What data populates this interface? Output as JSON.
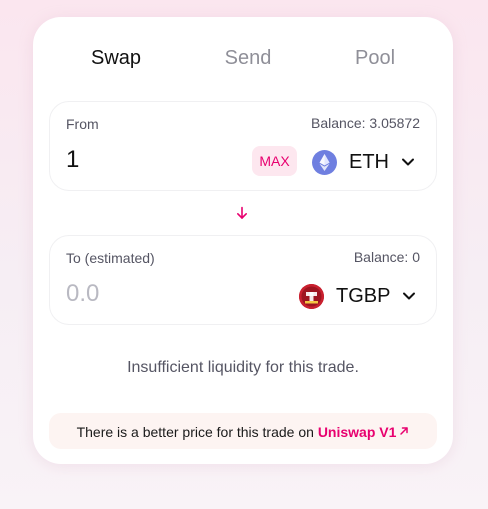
{
  "tabs": {
    "swap": "Swap",
    "send": "Send",
    "pool": "Pool"
  },
  "from_panel": {
    "label": "From",
    "balance": "Balance: 3.05872",
    "amount": "1",
    "max_label": "MAX",
    "token": {
      "symbol": "ETH",
      "icon": "ethereum-icon"
    }
  },
  "to_panel": {
    "label": "To (estimated)",
    "balance": "Balance: 0",
    "amount_placeholder": "0.0",
    "token": {
      "symbol": "TGBP",
      "icon": "tgbp-token-icon"
    }
  },
  "message": "Insufficient liquidity for this trade.",
  "notice": {
    "text": "There is a better price for this trade on ",
    "link": "Uniswap V1",
    "link_icon": "external-link-arrow-icon"
  },
  "colors": {
    "accent": "#e8006f",
    "max_bg": "#fde7ef",
    "notice_bg": "#fdf4f2"
  }
}
